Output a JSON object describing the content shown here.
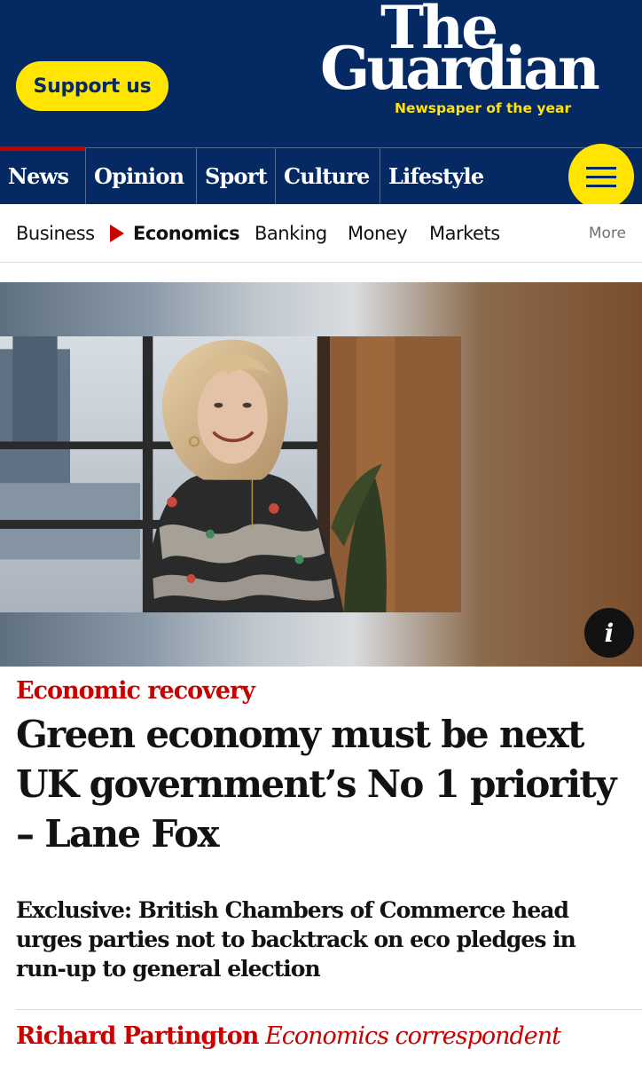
{
  "header": {
    "support_label": "Support us",
    "logo_line1": "The",
    "logo_line2": "Guardian",
    "tagline": "Newspaper of the year"
  },
  "nav": {
    "items": [
      "News",
      "Opinion",
      "Sport",
      "Culture",
      "Lifestyle"
    ],
    "active": "News"
  },
  "subnav": {
    "items": [
      "Business",
      "Economics",
      "Banking",
      "Money",
      "Markets"
    ],
    "active": "Economics",
    "more_label": "More"
  },
  "hero": {
    "info_label": "i"
  },
  "article": {
    "kicker": "Economic recovery",
    "headline": "Green economy must be next UK government’s No 1 priority – Lane Fox",
    "standfirst": "Exclusive: British Chambers of Commerce head urges parties not to backtrack on eco pledges in run-up to general election",
    "author": "Richard Partington",
    "role": "Economics correspondent"
  },
  "colors": {
    "brand_blue": "#052962",
    "support_yellow": "#ffe500",
    "news_red": "#c70000"
  }
}
